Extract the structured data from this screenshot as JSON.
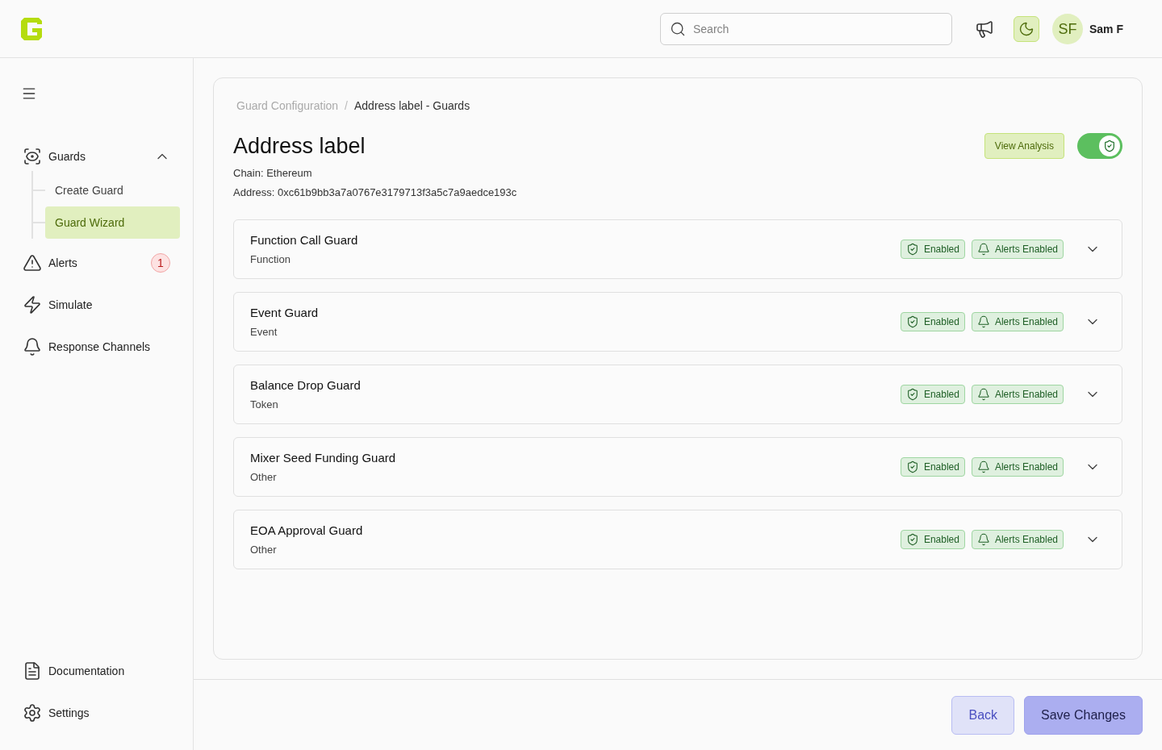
{
  "header": {
    "search": {
      "placeholder": "Search"
    },
    "dark_mode": {
      "on": true
    },
    "user": {
      "initials": "SF",
      "name": "Sam F"
    }
  },
  "sidebar": {
    "items": [
      {
        "kind": "guards",
        "label": "Guards",
        "expanded": true,
        "children": [
          {
            "label": "Create Guard",
            "selected": false
          },
          {
            "label": "Guard Wizard",
            "selected": true
          }
        ]
      },
      {
        "kind": "alerts",
        "label": "Alerts",
        "badge": "1"
      },
      {
        "kind": "simulate",
        "label": "Simulate"
      },
      {
        "kind": "channels",
        "label": "Response Channels"
      }
    ],
    "bottom_items": [
      {
        "kind": "docs",
        "label": "Documentation"
      },
      {
        "kind": "settings",
        "label": "Settings"
      }
    ]
  },
  "breadcrumb": {
    "items": [
      "Guard Configuration",
      "Address label - Guards"
    ],
    "separator": "/"
  },
  "page": {
    "title": "Address label",
    "chain": "Chain: Ethereum",
    "address": "Address: 0xc61b9bb3a7a0767e3179713f3a5c7a9aedce193c",
    "view_analysis": "View Analysis",
    "guard_toggle": {
      "on": true
    }
  },
  "guards": [
    {
      "name": "Function Call Guard",
      "type": "Function",
      "enabled": "Enabled",
      "alerts": "Alerts Enabled",
      "expanded": false
    },
    {
      "name": "Event Guard",
      "type": "Event",
      "enabled": "Enabled",
      "alerts": "Alerts Enabled",
      "expanded": false
    },
    {
      "name": "Balance Drop Guard",
      "type": "Token",
      "enabled": "Enabled",
      "alerts": "Alerts Enabled",
      "expanded": false
    },
    {
      "name": "Mixer Seed Funding Guard",
      "type": "Other",
      "enabled": "Enabled",
      "alerts": "Alerts Enabled",
      "expanded": false
    },
    {
      "name": "EOA Approval Guard",
      "type": "Other",
      "enabled": "Enabled",
      "alerts": "Alerts Enabled",
      "expanded": false
    }
  ],
  "footer": {
    "buttons": [
      "Back",
      "Save Changes"
    ]
  }
}
